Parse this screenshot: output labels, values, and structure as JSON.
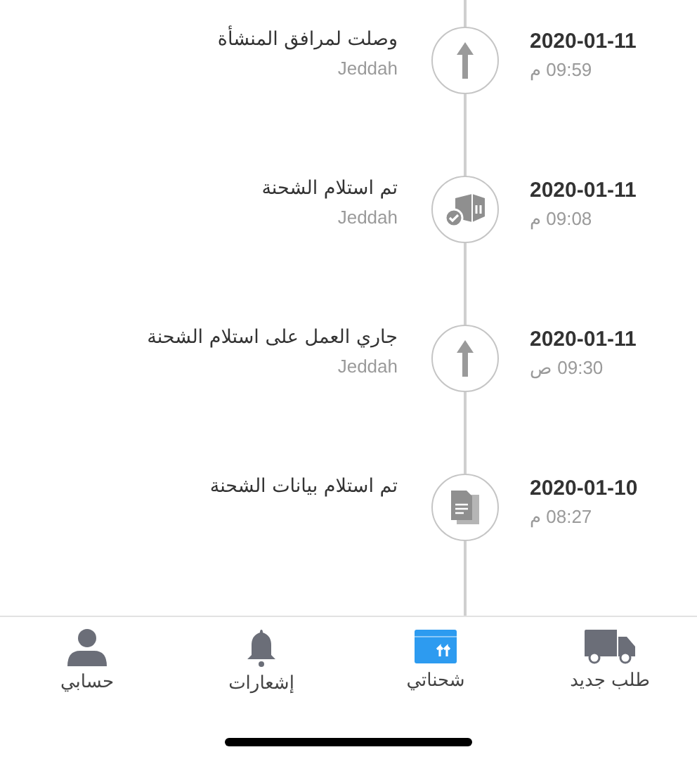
{
  "events": [
    {
      "date": "2020-01-11",
      "time": "09:59 م",
      "title": "وصلت لمرافق المنشأة",
      "location": "Jeddah",
      "kind": "arrow"
    },
    {
      "date": "2020-01-11",
      "time": "09:08 م",
      "title": "تم استلام الشحنة",
      "location": "Jeddah",
      "kind": "box"
    },
    {
      "date": "2020-01-11",
      "time": "09:30 ص",
      "title": "جاري العمل على استلام الشحنة",
      "location": "Jeddah",
      "kind": "arrow"
    },
    {
      "date": "2020-01-10",
      "time": "08:27 م",
      "title": "تم استلام بيانات الشحنة",
      "kind": "document"
    }
  ],
  "tabs": [
    {
      "label": "طلب جديد",
      "kind": "truck",
      "selected": false
    },
    {
      "label": "شحناتي",
      "kind": "box",
      "selected": true
    },
    {
      "label": "إشعارات",
      "kind": "bell",
      "selected": false
    },
    {
      "label": "حسابي",
      "kind": "person",
      "selected": false
    }
  ]
}
